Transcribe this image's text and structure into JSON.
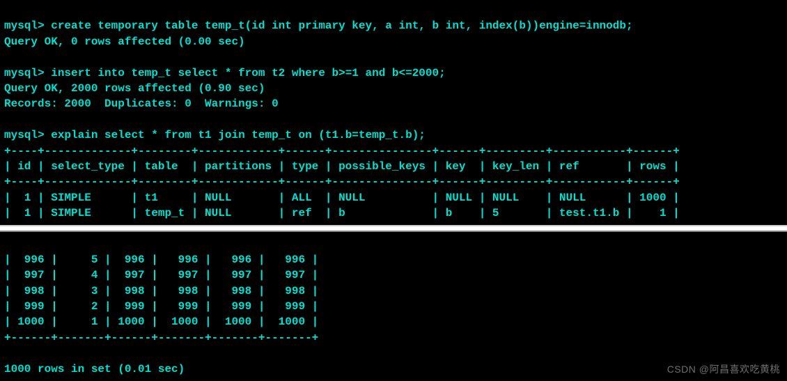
{
  "prompt": "mysql>",
  "cmd1": "create temporary table temp_t(id int primary key, a int, b int, index(b))engine=innodb;",
  "res1": "Query OK, 0 rows affected (0.00 sec)",
  "cmd2": "insert into temp_t select * from t2 where b>=1 and b<=2000;",
  "res2a": "Query OK, 2000 rows affected (0.90 sec)",
  "res2b": "Records: 2000  Duplicates: 0  Warnings: 0",
  "cmd3": "explain select * from t1 join temp_t on (t1.b=temp_t.b);",
  "explain": {
    "border": "+----+-------------+--------+------------+------+---------------+------+---------+-----------+------+",
    "header": "| id | select_type | table  | partitions | type | possible_keys | key  | key_len | ref       | rows |",
    "row1": "|  1 | SIMPLE      | t1     | NULL       | ALL  | NULL          | NULL | NULL    | NULL      | 1000 |",
    "row2": "|  1 | SIMPLE      | temp_t | NULL       | ref  | b             | b    | 5       | test.t1.b |    1 |"
  },
  "data_rows": {
    "r1": "|  996 |     5 |  996 |   996 |   996 |   996 |",
    "r2": "|  997 |     4 |  997 |   997 |   997 |   997 |",
    "r3": "|  998 |     3 |  998 |   998 |   998 |   998 |",
    "r4": "|  999 |     2 |  999 |   999 |   999 |   999 |",
    "r5": "| 1000 |     1 | 1000 |  1000 |  1000 |  1000 |",
    "border": "+------+-------+------+-------+-------+-------+"
  },
  "footer": "1000 rows in set (0.01 sec)",
  "watermark": "CSDN @阿昌喜欢吃黄桃"
}
